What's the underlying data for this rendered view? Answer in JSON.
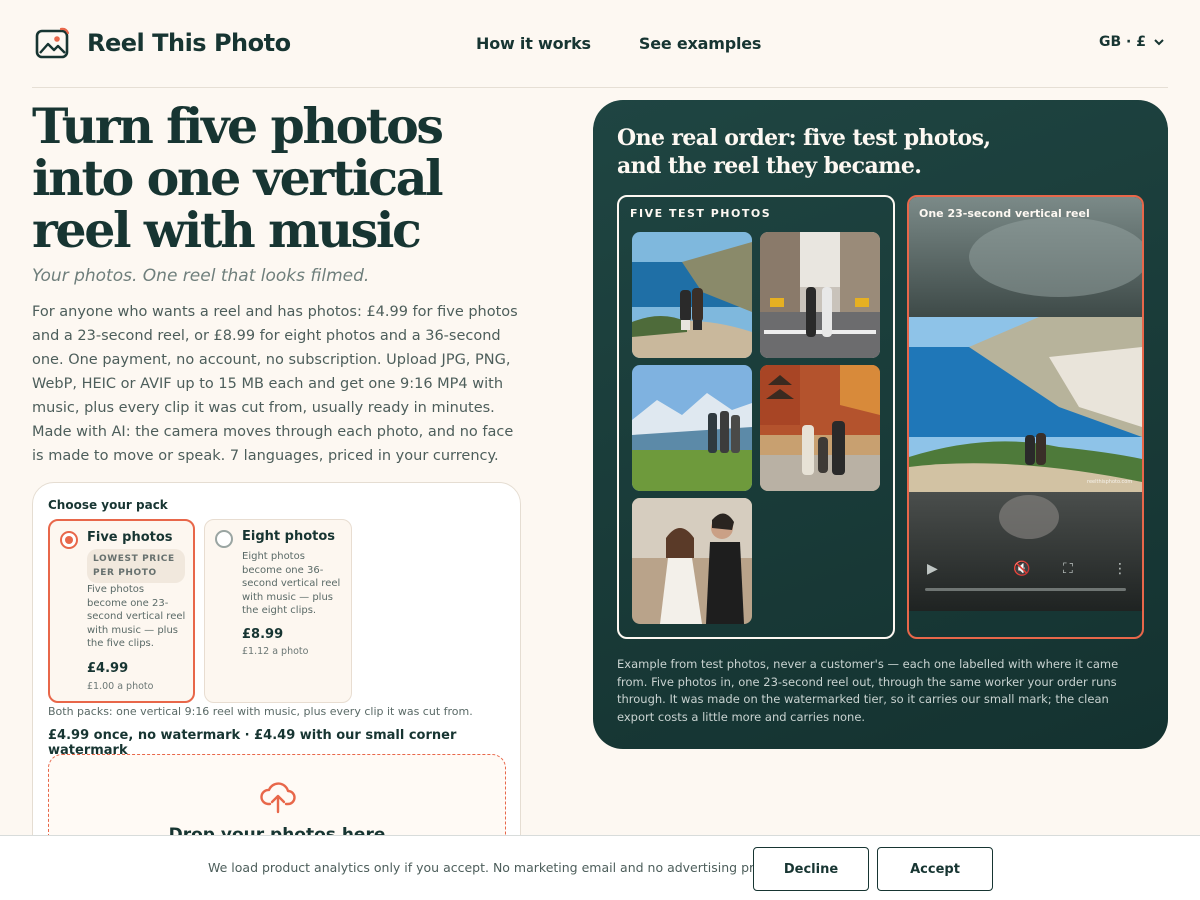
{
  "header": {
    "brand": "Reel This Photo",
    "nav": [
      "How it works",
      "See examples"
    ],
    "locale": "GB · £"
  },
  "hero": {
    "title": "Turn five photos into one vertical reel with music",
    "subtitle": "Your photos. One reel that looks filmed.",
    "body": "For anyone who wants a reel and has photos: £4.99 for five photos and a 23-second reel, or £8.99 for eight photos and a 36-second one. One payment, no account, no subscription. Upload JPG, PNG, WebP, HEIC or AVIF up to 15 MB each and get one 9:16 MP4 with music, plus every clip it was cut from, usually ready in minutes. Made with AI: the camera moves through each photo, and no face is made to move or speak. 7 languages, priced in your currency."
  },
  "packs": {
    "heading": "Choose your pack",
    "options": [
      {
        "title": "Five photos",
        "badge": "LOWEST PRICE PER PHOTO",
        "description": "Five photos become one 23-second vertical reel with music — plus the five clips.",
        "price": "£4.99",
        "per_photo": "£1.00 a photo",
        "selected": true
      },
      {
        "title": "Eight photos",
        "description": "Eight photos become one 36-second vertical reel with music — plus the eight clips.",
        "price": "£8.99",
        "per_photo": "£1.12 a photo",
        "selected": false
      }
    ],
    "both_note": "Both packs: one vertical 9:16 reel with music, plus every clip it was cut from.",
    "price_line": "£4.99 once, no watermark · £4.49 with our small corner watermark",
    "dropzone_text": "Drop your photos here"
  },
  "example": {
    "title": "One real order: five test photos, and the reel they became.",
    "photos_label": "FIVE TEST PHOTOS",
    "reel_label": "One 23-second vertical reel",
    "caption": "Example from test photos, never a customer's — each one labelled with where it came from. Five photos in, one 23-second reel out, through the same worker your order runs through. It was made on the watermarked tier, so it carries our small mark; the clean export costs a little more and carries none.",
    "watermark": "reelthisphoto.com"
  },
  "cookie": {
    "text": "We load product analytics only if you accept. No marketing email and no advertising profile.",
    "decline": "Decline",
    "accept": "Accept"
  },
  "colors": {
    "accent": "#e8674a",
    "dark_panel": "#1f4542",
    "background": "#fdf8f2",
    "ink": "#173532"
  }
}
